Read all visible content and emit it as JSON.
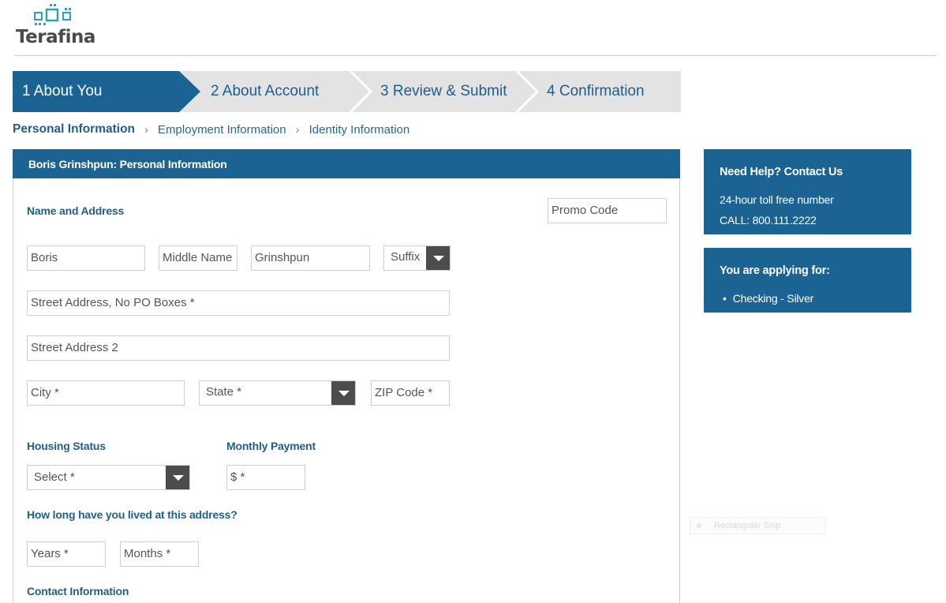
{
  "brand": {
    "name": "Terafina"
  },
  "steps": [
    {
      "label": "1 About You",
      "active": true
    },
    {
      "label": "2 About Account",
      "active": false
    },
    {
      "label": "3 Review & Submit",
      "active": false
    },
    {
      "label": "4 Confirmation",
      "active": false
    }
  ],
  "breadcrumb": {
    "current": "Personal Information",
    "separator": "›",
    "items": [
      "Employment Information",
      "Identity Information"
    ]
  },
  "panel": {
    "title": "Boris Grinshpun: Personal Information",
    "name_address_title": "Name and Address",
    "promo_code": {
      "value": "",
      "placeholder": "Promo Code"
    },
    "first_name": {
      "value": "Boris"
    },
    "middle_name": {
      "value": "",
      "placeholder": "Middle Name"
    },
    "last_name": {
      "value": "Grinshpun"
    },
    "suffix": {
      "selected": "Suffix"
    },
    "street1": {
      "value": "",
      "placeholder": "Street Address, No PO Boxes *"
    },
    "street2": {
      "value": "",
      "placeholder": "Street Address 2"
    },
    "city": {
      "value": "",
      "placeholder": "City *"
    },
    "state": {
      "selected": "State *"
    },
    "zip": {
      "value": "",
      "placeholder": "ZIP Code *"
    },
    "housing_status_title": "Housing Status",
    "housing_status": {
      "selected": "Select *"
    },
    "monthly_payment_title": "Monthly Payment",
    "monthly_payment": {
      "value": "",
      "placeholder": "$ *"
    },
    "duration_title": "How long have you lived at this address?",
    "years": {
      "value": "",
      "placeholder": "Years *"
    },
    "months": {
      "value": "",
      "placeholder": "Months *"
    },
    "contact_title": "Contact Information"
  },
  "help": {
    "title": "Need Help? Contact Us",
    "line1": "24-hour toll free number",
    "line2": "CALL: 800.111.2222"
  },
  "applying": {
    "title": "You are applying for:",
    "items": [
      "Checking - Silver"
    ]
  },
  "snip_overlay": {
    "label": "Rectangular Snip"
  },
  "colors": {
    "primary": "#1b6393",
    "step_bg": "#e3e3e3",
    "logo_accent": "#2aa3b8"
  }
}
